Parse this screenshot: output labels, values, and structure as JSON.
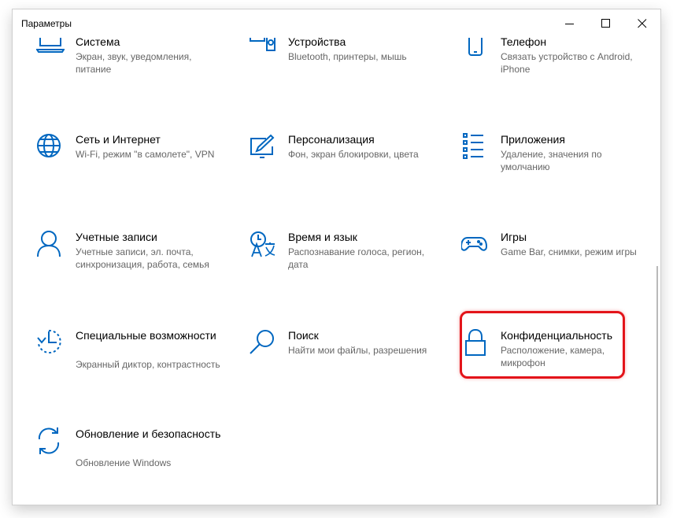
{
  "window": {
    "title": "Параметры",
    "minimize_icon": "minimize-icon",
    "maximize_icon": "maximize-icon",
    "close_icon": "close-icon"
  },
  "accent_color": "#0067c0",
  "highlight_color": "#e3141a",
  "tiles": [
    {
      "icon": "laptop-icon",
      "title": "Система",
      "description": "Экран, звук, уведомления, питание"
    },
    {
      "icon": "devices-icon",
      "title": "Устройства",
      "description": "Bluetooth, принтеры, мышь"
    },
    {
      "icon": "phone-icon",
      "title": "Телефон",
      "description": "Связать устройство с Android, iPhone"
    },
    {
      "icon": "globe-icon",
      "title": "Сеть и Интернет",
      "description": "Wi-Fi, режим \"в самолете\", VPN"
    },
    {
      "icon": "personalization-icon",
      "title": "Персонализация",
      "description": "Фон, экран блокировки, цвета"
    },
    {
      "icon": "apps-list-icon",
      "title": "Приложения",
      "description": "Удаление, значения по умолчанию"
    },
    {
      "icon": "person-icon",
      "title": "Учетные записи",
      "description": "Учетные записи, эл. почта, синхронизация, работа, семья"
    },
    {
      "icon": "time-language-icon",
      "title": "Время и язык",
      "description": "Распознавание голоса, регион, дата"
    },
    {
      "icon": "gamepad-icon",
      "title": "Игры",
      "description": "Game Bar, снимки, режим игры"
    },
    {
      "icon": "ease-of-access-icon",
      "title": "Специальные возможности",
      "description": "Экранный диктор, контрастность"
    },
    {
      "icon": "search-icon",
      "title": "Поиск",
      "description": "Найти мои файлы, разрешения"
    },
    {
      "icon": "lock-icon",
      "title": "Конфиденциальность",
      "description": "Расположение, камера, микрофон"
    },
    {
      "icon": "update-icon",
      "title": "Обновление и безопасность",
      "description": "Обновление Windows"
    }
  ]
}
